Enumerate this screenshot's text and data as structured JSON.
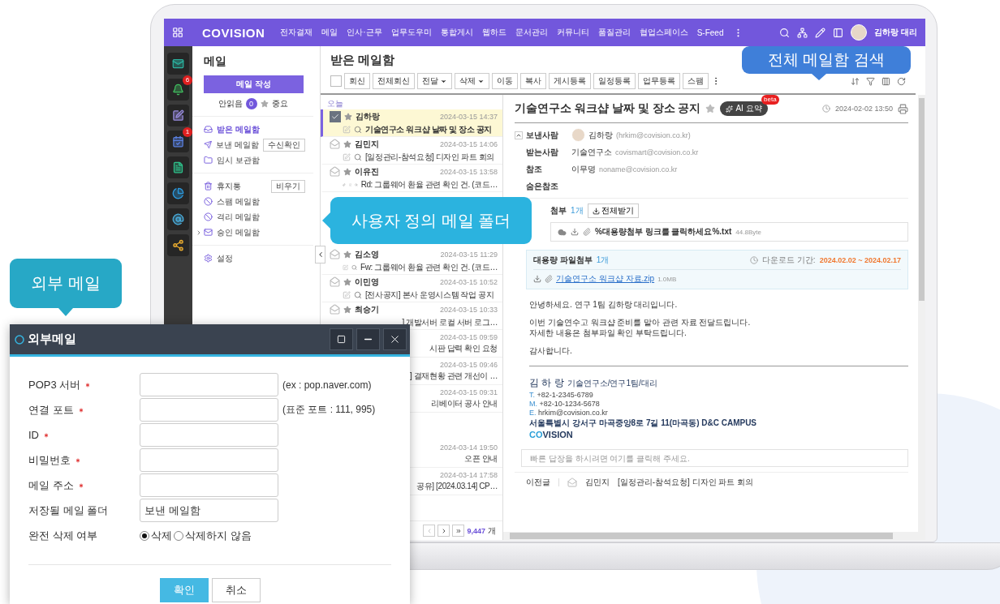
{
  "nav": {
    "logo": "COVISION",
    "menu": [
      "전자결재",
      "메일",
      "인사·근무",
      "업무도우미",
      "통합게시",
      "웹하드",
      "문서관리",
      "커뮤니티",
      "품질관리",
      "협업스페이스",
      "S-Feed"
    ],
    "user": "김하랑 대리"
  },
  "rail": [
    {
      "kind": "mail"
    },
    {
      "kind": "bell",
      "badge": "6"
    },
    {
      "kind": "note"
    },
    {
      "kind": "calendar",
      "badge": "1"
    },
    {
      "kind": "doc"
    },
    {
      "kind": "chart"
    },
    {
      "kind": "contacts"
    },
    {
      "kind": "share"
    }
  ],
  "sidebar": {
    "title": "메일",
    "compose": "메일 작성",
    "unread_label": "안읽음",
    "unread_count": "0",
    "important_label": "중요",
    "sections": [
      [
        {
          "kind": "inbox",
          "label": "받은 메일함",
          "selected": true
        },
        {
          "kind": "sent",
          "label": "보낸 메일함",
          "selected": false,
          "action": "수신확인"
        },
        {
          "kind": "drafts",
          "label": "임시 보관함",
          "selected": false
        }
      ],
      [
        {
          "kind": "trash",
          "label": "휴지통",
          "selected": false,
          "action": "비우기"
        },
        {
          "kind": "blocked",
          "label": "스팸 메일함",
          "selected": false
        },
        {
          "kind": "blocked",
          "label": "격리 메일함",
          "selected": false
        },
        {
          "kind": "approval",
          "label": "승인 메일함",
          "selected": false,
          "expanded": false
        }
      ],
      [
        {
          "kind": "settings",
          "label": "설정",
          "selected": false
        }
      ]
    ]
  },
  "mailbox": {
    "title": "받은 메일함",
    "select_all_checked": false,
    "toolbar": [
      {
        "label": "회신",
        "dropdown": false
      },
      {
        "label": "전체회신",
        "dropdown": false
      },
      {
        "label": "전달",
        "dropdown": true
      },
      {
        "label": "삭제",
        "dropdown": true
      },
      {
        "label": "이동",
        "dropdown": false
      },
      {
        "label": "복사",
        "dropdown": false
      },
      {
        "label": "게시등록",
        "dropdown": false
      },
      {
        "label": "일정등록",
        "dropdown": false
      },
      {
        "label": "업무등록",
        "dropdown": false
      },
      {
        "label": "스팸",
        "dropdown": false
      }
    ]
  },
  "list": {
    "group": "오늘",
    "total_count": "9,447",
    "total_unit": "개",
    "rows": [
      {
        "kind": "full",
        "sender": "김하랑",
        "date": "2024-03-15 14:37",
        "subject": "기술연구소 워크샵 날짜 및 장소 공지",
        "selected": true,
        "checked": true,
        "starred": false,
        "attachment": false
      },
      {
        "kind": "full",
        "sender": "김민지",
        "date": "2024-03-15 14:06",
        "subject": "[일정관리-참석요청] 디자인 파트 회의",
        "selected": false,
        "checked": false,
        "starred": false,
        "attachment": false
      },
      {
        "kind": "full",
        "sender": "이유진",
        "date": "2024-03-15 13:58",
        "subject": "Rd: 그룹웨어 환율 관련 확인 건. (코드…",
        "selected": false,
        "checked": false,
        "starred": false,
        "attachment": true
      },
      {
        "kind": "covered"
      },
      {
        "kind": "full",
        "sender": "김소영",
        "date": "2024-03-15 11:29",
        "subject": "Fw: 그룹웨어 환율 관련 확인 건. (코드…",
        "selected": false,
        "checked": false,
        "starred": false,
        "attachment": false
      },
      {
        "kind": "full",
        "sender": "이민영",
        "date": "2024-03-15 10:52",
        "subject": "[전사공지] 본사 운영시스템 작업 공지",
        "selected": false,
        "checked": false,
        "starred": false,
        "attachment": false
      },
      {
        "kind": "clipped",
        "sender": "최승기",
        "date": "2024-03-15 10:33",
        "subject": "] 개발서버 로컬 서버 로그…",
        "selected": false,
        "checked": false,
        "starred": false
      },
      {
        "kind": "clipped",
        "date": "2024-03-15 09:59",
        "subject": "시판 답력 확인 요청",
        "selected": false
      },
      {
        "kind": "clipped",
        "date": "2024-03-15 09:46",
        "subject": "] 결재현황 관련 개선이 …",
        "selected": false
      },
      {
        "kind": "clipped",
        "date": "2024-03-15 09:31",
        "subject": "리베이터 공사 안내",
        "selected": false
      },
      {
        "kind": "gap"
      },
      {
        "kind": "clipped",
        "date": "2024-03-14 19:50",
        "subject": "오픈 안내",
        "selected": false
      },
      {
        "kind": "clipped",
        "date": "2024-03-14 17:58",
        "subject": "공유] [2024.03.14] CP…",
        "selected": false
      }
    ]
  },
  "reading": {
    "title": "기술연구소 워크샵 날짜 및 장소 공지",
    "starred": false,
    "ai_label": "AI 요약",
    "ai_badge": "beta",
    "date": "2024-02-02 13:50",
    "headers": [
      {
        "kind": "sender",
        "label": "보낸사람",
        "name": "김하랑",
        "address": "(hrkim@covision.co.kr)"
      },
      {
        "kind": "plain",
        "label": "받는사람",
        "name": "기술연구소",
        "address": "covismart@covision.co.kr"
      },
      {
        "kind": "plain",
        "label": "참조",
        "name": "이무명",
        "address": "noname@covision.co.kr"
      },
      {
        "kind": "plain",
        "label": "숨은참조"
      }
    ],
    "attach": {
      "label": "첨부",
      "count": "1개",
      "download_all": "전체받기",
      "file": "%대용량첨부 링크를 클릭하세요%.txt",
      "size": "44.8Byte"
    },
    "bigfile": {
      "label": "대용량 파일첨부",
      "count": "1개",
      "period_label": "다운로드 기간:",
      "period": "2024.02.02 ~ 2024.02.17",
      "file": "기술연구소 워크샵 자료.zip",
      "size": "1.0MB"
    },
    "body": [
      {
        "lines": [
          "안녕하세요. 연구 1팀 김하랑 대리입니다."
        ]
      },
      {
        "lines": [
          "이번 기술연수고 워크샵 준비를 맡아 관련 자료 전달드립니다.",
          "자세한 내용은 첨부파일 확인 부탁드립니다."
        ]
      },
      {
        "lines": [
          "감사합니다."
        ]
      }
    ],
    "signature": {
      "name": "김 하 랑",
      "title": "기술연구소/연구1팀/대리",
      "contacts": [
        {
          "prefix": "T.",
          "value": "+82-1-2345-6789"
        },
        {
          "prefix": "M.",
          "value": "+82-10-1234-5678"
        },
        {
          "prefix": "E.",
          "value": "hrkim@covision.co.kr"
        }
      ],
      "address": "서울특별시 강서구 마곡중앙8로 7길 11(마곡동) D&C CAMPUS",
      "company_accent": "CO",
      "company_rest": "VISION"
    },
    "quick_reply": {
      "placeholder": "빠른 답장을 하시려면 여기를 클릭해 주세요."
    },
    "previous": {
      "label": "이전글",
      "sender": "김민지",
      "subject": "[일정관리-참석요청] 디자인 파트 회의"
    }
  },
  "callouts": {
    "search": "전체 메일함 검색",
    "folder": "사용자 정의 메일 폴더",
    "external": "외부 메일"
  },
  "dialog": {
    "title": "외부메일",
    "fields": [
      {
        "label": "POP3 서버",
        "required": true,
        "hint": "(ex : pop.naver.com)"
      },
      {
        "label": "연결 포트",
        "required": true,
        "hint": "(표준 포트 : 111, 995)"
      },
      {
        "label": "ID",
        "required": true
      },
      {
        "label": "비밀번호",
        "required": true
      },
      {
        "label": "메일 주소",
        "required": true
      },
      {
        "label": "저장될 메일 폴더",
        "required": false,
        "value": "보낸 메일함"
      }
    ],
    "delete_option": {
      "label": "완전 삭제 여부",
      "options": [
        {
          "label": "삭제",
          "selected": true
        },
        {
          "label": "삭제하지 않음",
          "selected": false
        }
      ]
    },
    "buttons": [
      {
        "kind": "primary",
        "label": "확인"
      },
      {
        "kind": "secondary",
        "label": "취소"
      }
    ]
  }
}
